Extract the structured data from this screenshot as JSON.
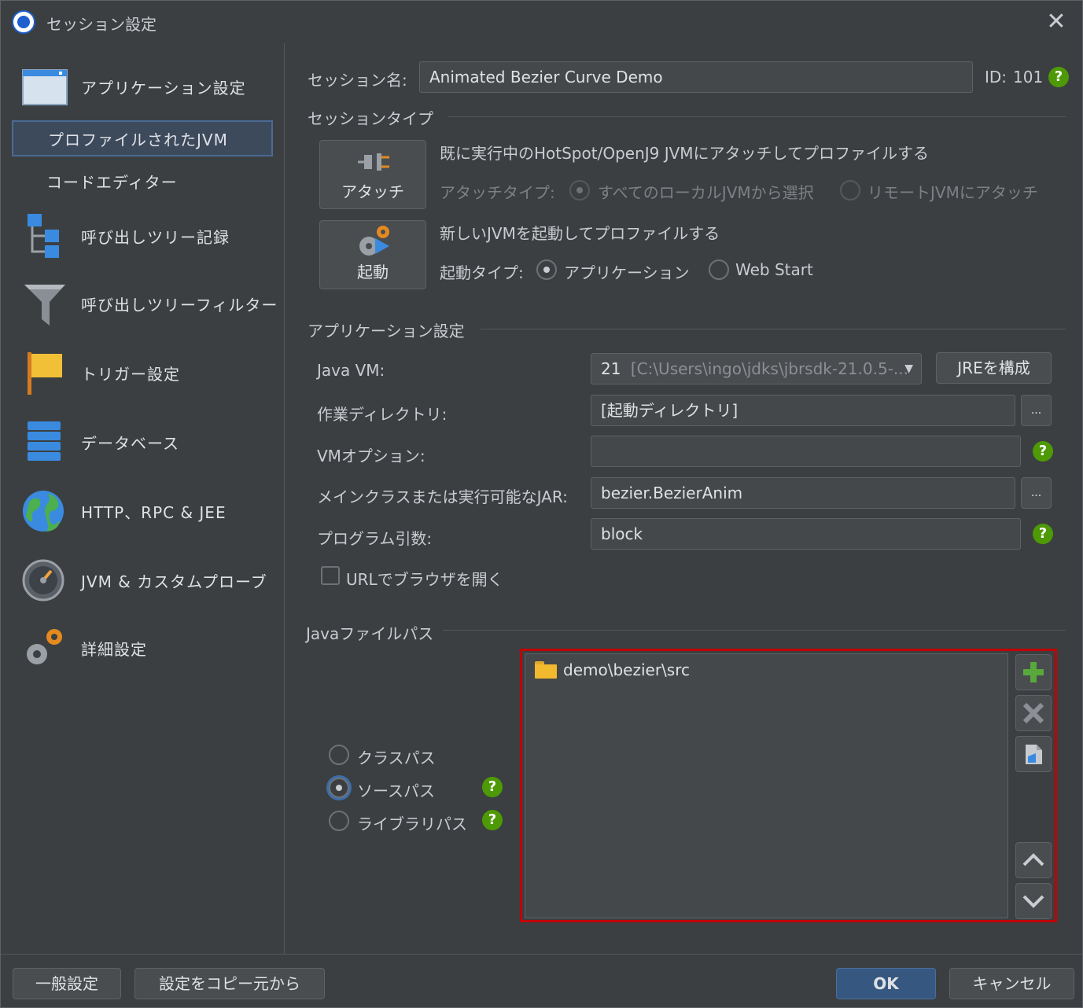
{
  "window": {
    "title": "セッション設定",
    "close": "✕"
  },
  "sidebar": {
    "items": [
      {
        "label": "アプリケーション設定"
      },
      {
        "label": "プロファイルされたJVM"
      },
      {
        "label": "コードエディター"
      },
      {
        "label": "呼び出しツリー記録"
      },
      {
        "label": "呼び出しツリーフィルター"
      },
      {
        "label": "トリガー設定"
      },
      {
        "label": "データベース"
      },
      {
        "label": "HTTP、RPC & JEE"
      },
      {
        "label": "JVM & カスタムプローブ"
      },
      {
        "label": "詳細設定"
      }
    ]
  },
  "session": {
    "name_label": "セッション名:",
    "name_value": "Animated Bezier Curve Demo",
    "id_label": "ID:",
    "id_value": "101",
    "help": "?"
  },
  "session_type": {
    "title": "セッションタイプ",
    "attach_button": "アタッチ",
    "attach_desc": "既に実行中のHotSpot/OpenJ9 JVMにアタッチしてプロファイルする",
    "attach_type_label": "アタッチタイプ:",
    "attach_local": "すべてのローカルJVMから選択",
    "attach_remote": "リモートJVMにアタッチ",
    "launch_button": "起動",
    "launch_desc": "新しいJVMを起動してプロファイルする",
    "launch_type_label": "起動タイプ:",
    "launch_app": "アプリケーション",
    "launch_webstart": "Web Start"
  },
  "app_settings": {
    "title": "アプリケーション設定",
    "java_vm_label": "Java VM:",
    "java_vm_version": "21",
    "java_vm_path": "[C:\\Users\\ingo\\jdks\\jbrsdk-21.0.5-...",
    "configure_jre": "JREを構成",
    "workdir_label": "作業ディレクトリ:",
    "workdir_value": "[起動ディレクトリ]",
    "browse": "...",
    "vm_options_label": "VMオプション:",
    "vm_options_value": "",
    "main_class_label": "メインクラスまたは実行可能なJAR:",
    "main_class_value": "bezier.BezierAnim",
    "args_label": "プログラム引数:",
    "args_value": "block",
    "open_browser_label": "URLでブラウザを開く"
  },
  "java_path": {
    "title": "Javaファイルパス",
    "classpath": "クラスパス",
    "sourcepath": "ソースパス",
    "librarypath": "ライブラリパス",
    "entries": [
      "demo\\bezier\\src"
    ]
  },
  "footer": {
    "general": "一般設定",
    "copy_from": "設定をコピー元から",
    "ok": "OK",
    "cancel": "キャンセル"
  },
  "colors": {
    "background": "#3c3f41",
    "accent": "#365880",
    "help": "#4e9a06",
    "highlight": "#c00000"
  }
}
